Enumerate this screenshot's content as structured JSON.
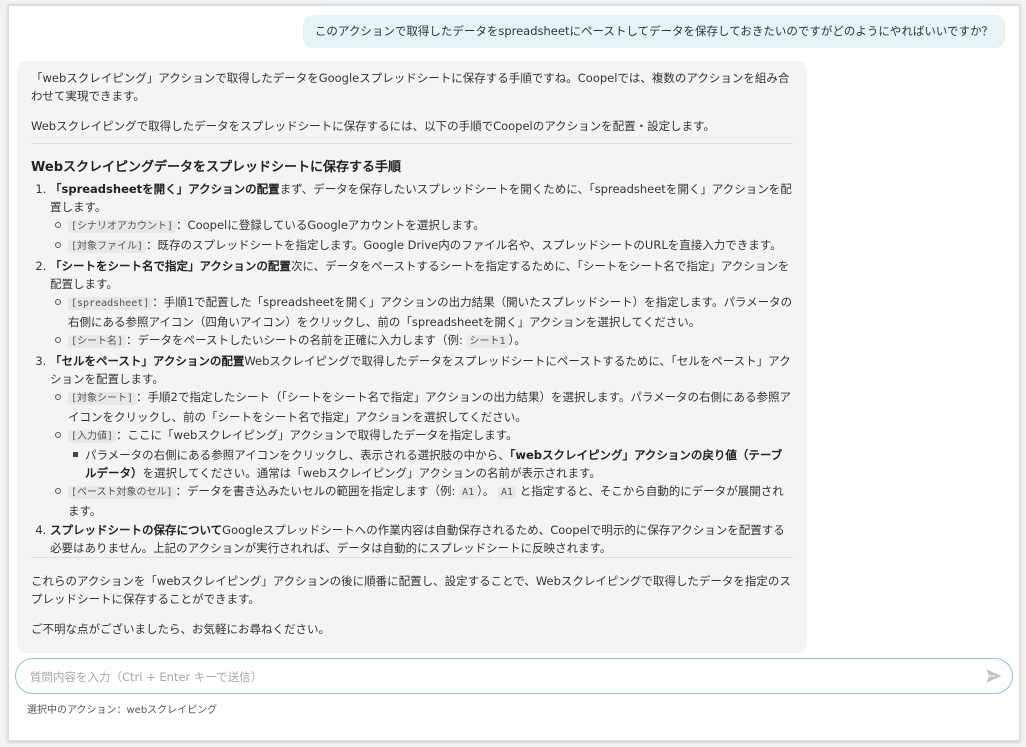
{
  "user_message": "このアクションで取得したデータをspreadsheetにペーストしてデータを保存しておきたいのですがどのようにやればいいですか？",
  "reply": {
    "intro": "「webスクレイピング」アクションで取得したデータをGoogleスプレッドシートに保存する手順ですね。Coopelでは、複数のアクションを組み合わせて実現できます。",
    "intro2": "Webスクレイピングで取得したデータをスプレッドシートに保存するには、以下の手順でCoopelのアクションを配置・設定します。",
    "section_title": "Webスクレイピングデータをスプレッドシートに保存する手順",
    "steps": [
      {
        "title": "「spreadsheetを開く」アクションの配置",
        "text": "まず、データを保存したいスプレッドシートを開くために、「spreadsheetを開く」アクションを配置します。",
        "params": [
          {
            "code": "[シナリオアカウント]",
            "text": "：Coopelに登録しているGoogleアカウントを選択します。"
          },
          {
            "code": "[対象ファイル]",
            "text": "：既存のスプレッドシートを指定します。Google Drive内のファイル名や、スプレッドシートのURLを直接入力できます。"
          }
        ]
      },
      {
        "title": "「シートをシート名で指定」アクションの配置",
        "text": "次に、データをペーストするシートを指定するために、「シートをシート名で指定」アクションを配置します。",
        "params": [
          {
            "code": "[spreadsheet]",
            "text": "：手順1で配置した「spreadsheetを開く」アクションの出力結果（開いたスプレッドシート）を指定します。パラメータの右側にある参照アイコン（四角いアイコン）をクリックし、前の「spreadsheetを開く」アクションを選択してください。"
          },
          {
            "code": "[シート名]",
            "text": "：データをペーストしたいシートの名前を正確に入力します（例:",
            "example": "シート1",
            "end": "）。"
          }
        ]
      },
      {
        "title": "「セルをペースト」アクションの配置",
        "text": "Webスクレイピングで取得したデータをスプレッドシートにペーストするために、「セルをペースト」アクションを配置します。",
        "params": [
          {
            "code": "[対象シート]",
            "text": "：手順2で指定したシート（「シートをシート名で指定」アクションの出力結果）を選択します。パラメータの右側にある参照アイコンをクリックし、前の「シートをシート名で指定」アクションを選択してください。"
          },
          {
            "code": "[入力値]",
            "text": "：ここに「webスクレイピング」アクションで取得したデータを指定します。",
            "sub": {
              "pre": "パラメータの右側にある参照アイコンをクリックし、表示される選択肢の中から、",
              "bold": "「webスクレイピング」アクションの戻り値（テーブルデータ）",
              "post": "を選択してください。通常は「webスクレイピング」アクションの名前が表示されます。"
            }
          },
          {
            "code": "[ペースト対象のセル]",
            "text": "：データを書き込みたいセルの範囲を指定します（例:",
            "code2": "A1",
            "mid": "）。",
            "code3": "A1",
            "end": "と指定すると、そこから自動的にデータが展開されます。"
          }
        ]
      },
      {
        "title": "スプレッドシートの保存について",
        "text": "Googleスプレッドシートへの作業内容は自動保存されるため、Coopelで明示的に保存アクションを配置する必要はありません。上記のアクションが実行されれば、データは自動的にスプレッドシートに反映されます。"
      }
    ],
    "outro": "これらのアクションを「webスクレイピング」アクションの後に順番に配置し、設定することで、Webスクレイピングで取得したデータを指定のスプレッドシートに保存することができます。",
    "outro2": "ご不明な点がございましたら、お気軽にお尋ねください。"
  },
  "input": {
    "placeholder": "質問内容を入力（Ctrl + Enter キーで送信）",
    "value": ""
  },
  "status": {
    "text": "選択中のアクション：webスクレイピング"
  },
  "icons": {
    "send": "send-icon"
  },
  "colors": {
    "user_bubble": "#e6f4f8",
    "reply_bg": "#f4f4f4",
    "input_border": "#8fc6da"
  }
}
